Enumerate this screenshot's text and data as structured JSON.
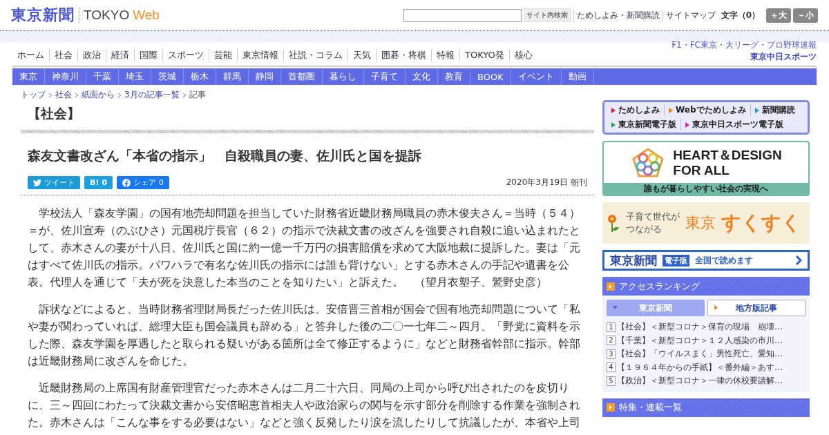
{
  "header": {
    "logo": {
      "name": "東京新聞",
      "tokyo": "TOKYO",
      "web": "Web"
    },
    "search": {
      "button": "サイト内検索"
    },
    "links": [
      "ためしよみ・新聞購読",
      "サイトマップ"
    ],
    "font_size": {
      "label": "文字（0）",
      "buttons": [
        "＋大",
        "－小"
      ]
    }
  },
  "nav": [
    "ホーム",
    "社会",
    "政治",
    "経済",
    "国際",
    "スポーツ",
    "芸能",
    "東京情報",
    "社説・コラム",
    "天気",
    "囲碁・将棋",
    "特報",
    "TOKYO発",
    "核心"
  ],
  "sports_promo": {
    "line": "F1・FC東京・大リーグ・プロ野球速報",
    "logo": "東京中日スポーツ"
  },
  "regions": [
    "東京",
    "神奈川",
    "千葉",
    "埼玉",
    "茨城",
    "栃木",
    "群馬",
    "静岡",
    "首都圏",
    "暮らし",
    "子育て",
    "文化",
    "教育",
    "BOOK",
    "イベント",
    "動画"
  ],
  "breadcrumb": [
    {
      "label": "トップ",
      "link": true
    },
    {
      "label": "社会",
      "link": true
    },
    {
      "label": "紙面から",
      "link": true
    },
    {
      "label": "3月の記事一覧",
      "link": true
    },
    {
      "label": "記事",
      "link": false
    }
  ],
  "section": "【社会】",
  "article": {
    "title": "森友文書改ざん「本省の指示」　自殺職員の妻、佐川氏と国を提訴",
    "share": [
      {
        "kind": "twitter",
        "label": "ツイート"
      },
      {
        "kind": "hatena",
        "label": "B!",
        "count": "0"
      },
      {
        "kind": "facebook",
        "label": "シェア",
        "count": "0"
      }
    ],
    "date": "2020年3月19日 朝刊",
    "paragraphs": [
      "　学校法人「森友学園」の国有地売却問題を担当していた財務省近畿財務局職員の赤木俊夫さん＝当時（５４）＝が、佐川宣寿（のぶひさ）元国税庁長官（６２）の指示で決裁文書の改ざんを強要され自殺に追い込まれたとして、赤木さんの妻が十八日、佐川氏と国に約一億一千万円の損害賠償を求めて大阪地裁に提訴した。妻は「元はすべて佐川氏の指示。パワハラで有名な佐川氏の指示には誰も背けない」とする赤木さんの手記や遺書を公表。代理人を通じて「夫が死を決意した本当のことを知りたい」と訴えた。　（望月衣塑子、鷲野史彦）",
      "　訴状などによると、当時財務省理財局長だった佐川氏は、安倍晋三首相が国会で国有地売却問題について「私や妻が関わっていれば、総理大臣も国会議員も辞める」と答弁した後の二〇一七年二～四月、「野党に資料を示した際、森友学園を厚遇したと取られる疑いがある箇所は全て修正するように」などと財務省幹部に指示。幹部は近畿財務局に改ざんを命じた。",
      "　近畿財務局の上席国有財産管理官だった赤木さんは二月二十六日、同局の上司から呼び出されたのを皮切りに、三～四回にわたって決裁文書から安倍昭恵首相夫人や政治家らの関与を示す部分を削除する作業を強制された。赤木さんは「こんな事をする必要はない」などと強く反発したり涙を流したりして抗議したが、本省や上司"
    ]
  },
  "sidebar": {
    "quick_links": [
      {
        "label": "ためしよみ",
        "color": "#e8202a"
      },
      {
        "label": "Webでためしよみ",
        "color": "#f07a10"
      },
      {
        "label": "新聞購読",
        "color": "#1f9ad6"
      },
      {
        "label": "東京新聞電子版",
        "color": "#2aa34a"
      },
      {
        "label": "東京中日スポーツ電子版",
        "color": "#e020c8"
      }
    ],
    "heart_banner": {
      "title": "HEART＆DESIGN",
      "subtitle": "FOR ALL",
      "caption": "誰もが暮らしやすい社会の実現へ"
    },
    "sukusuku_banner": {
      "line1": "子育て世代が",
      "line2": "つながる",
      "place": "東京",
      "name": "すくすく"
    },
    "digital_banner": {
      "logo": "東京新聞",
      "badge": "電子版",
      "text": "全国で読めます"
    },
    "ranking": {
      "title": "アクセスランキング",
      "tabs": [
        {
          "label": "東京新聞",
          "selected": true
        },
        {
          "label": "地方版記事",
          "selected": false
        }
      ],
      "items": [
        {
          "rank": "1",
          "text": "【社会】＜新型コロナ＞保育の現場　崩壊…"
        },
        {
          "rank": "2",
          "text": "【千葉】＜新型コロナ＞１２人感染の市川…"
        },
        {
          "rank": "3",
          "text": "【社会】「ウイルスまく」男性死亡、愛知…"
        },
        {
          "rank": "4",
          "text": "【１９６４年からの手紙】＜番外編＞あす…"
        },
        {
          "rank": "5",
          "text": "【政治】＜新型コロナ＞一律の休校要請解…"
        }
      ]
    },
    "features": {
      "title": "特集・連載一覧"
    }
  }
}
